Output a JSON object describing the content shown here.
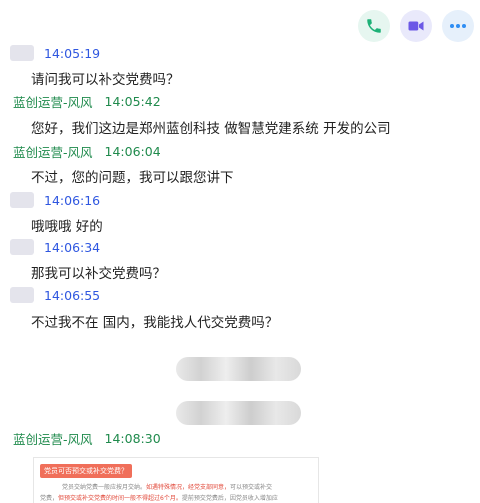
{
  "toolbar": {
    "phone": {
      "icon": "phone-icon",
      "color": "#1db177"
    },
    "video": {
      "icon": "video-icon",
      "color": "#6b58e6"
    },
    "more": {
      "icon": "more-icon",
      "color": "#2f8ef4"
    }
  },
  "messages": [
    {
      "time": "14:05:19",
      "text": "请问我可以补交党费吗？"
    },
    {
      "sender": "蓝创运营-风风",
      "time": "14:05:42",
      "text": "您好，我们这边是郑州蓝创科技 做智慧党建系统 开发的公司"
    },
    {
      "sender": "蓝创运营-风风",
      "time": "14:06:04",
      "text": "不过，您的问题，我可以跟您讲下"
    },
    {
      "time": "14:06:16",
      "text": "哦哦哦 好的"
    },
    {
      "time": "14:06:34",
      "text": "那我可以补交党费吗？"
    },
    {
      "time": "14:06:55",
      "text": "不过我不在 国内，我能找人代交党费吗？"
    },
    {
      "sender": "蓝创运营-风风",
      "time": "14:08:30"
    }
  ],
  "card": {
    "title": "党员可否预交或补交党费？",
    "line1_a": "党员交纳党费一般应按月交纳。",
    "line1_red": "如遇特殊情况，经党支部同意，",
    "line1_b": "可以预交或补交",
    "line2_a": "党费，",
    "line2_red": "但预交或补交党费的时间一般不得超过6个月。",
    "line2_b": "提前预交党费后，因党员收入增加应"
  },
  "colors": {
    "time_blue": "#2f57e0",
    "sender_green": "#1f8a4c",
    "card_accent": "#f06f5a"
  }
}
